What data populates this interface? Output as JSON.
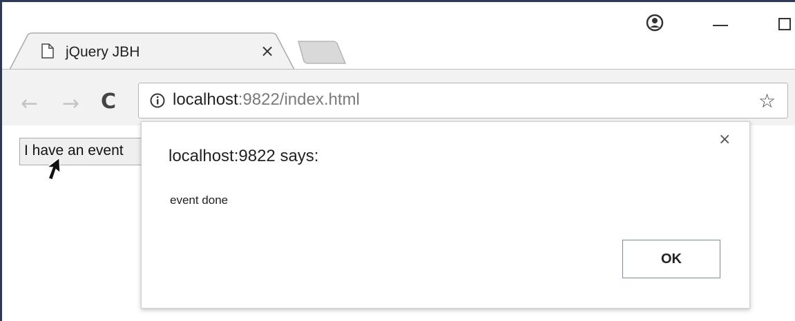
{
  "browser": {
    "tab": {
      "title": "jQuery JBH",
      "close_glyph": "×"
    },
    "address_bar": {
      "host": "localhost",
      "rest": ":9822/index.html"
    },
    "icons": {
      "back": "←",
      "forward": "→",
      "reload": "C",
      "star": "☆"
    }
  },
  "page": {
    "button_label": "I have an event"
  },
  "dialog": {
    "title": "localhost:9822 says:",
    "message": "event done",
    "ok_label": "OK",
    "close_glyph": "×"
  },
  "colors": {
    "frame": "#2b3a55",
    "toolbar": "#f2f2f2",
    "ok_border": "#7c8aa0"
  }
}
